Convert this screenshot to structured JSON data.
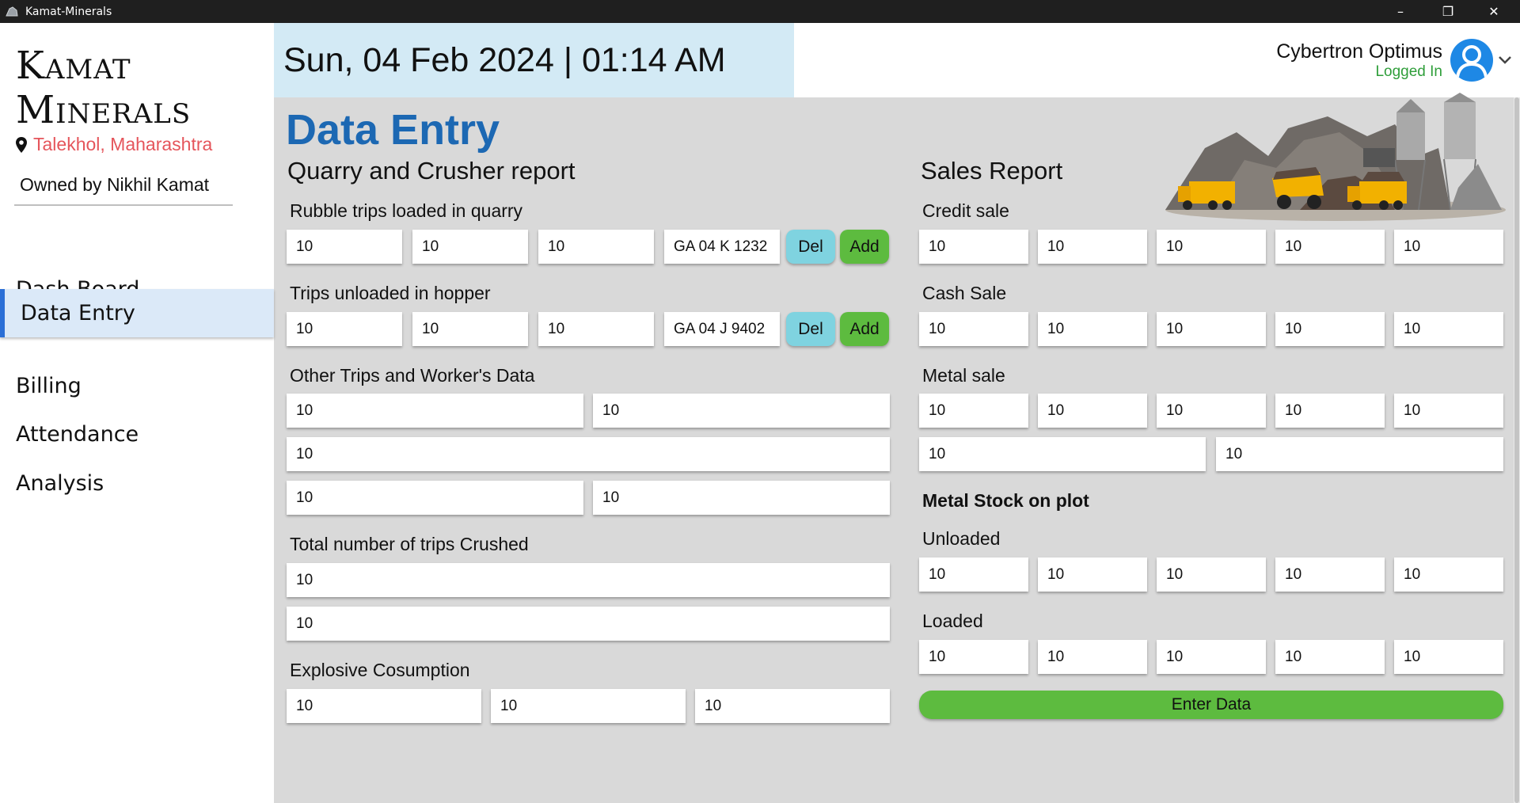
{
  "window": {
    "title": "Kamat-Minerals",
    "controls": [
      "–",
      "❐",
      "✕"
    ]
  },
  "sidebar": {
    "brand_line1": "Kamat",
    "brand_line2": "Minerals",
    "location": "Talekhol, Maharashtra",
    "owner": "Owned by Nikhil Kamat",
    "items": [
      {
        "label": "Dash Board"
      },
      {
        "label": "Data Entry",
        "active": true
      },
      {
        "label": "Billing"
      },
      {
        "label": "Attendance"
      },
      {
        "label": "Analysis"
      }
    ]
  },
  "header": {
    "datetime": "Sun, 04 Feb 2024 | 01:14 AM",
    "user_name": "Cybertron Optimus",
    "user_status": "Logged In"
  },
  "main": {
    "title": "Data Entry",
    "quarry": {
      "title": "Quarry and Crusher report",
      "rubble_label": "Rubble trips loaded in quarry",
      "rubble_values": [
        "10",
        "10",
        "10",
        "GA 04 K 1232"
      ],
      "hopper_label": "Trips unloaded in hopper",
      "hopper_values": [
        "10",
        "10",
        "10",
        "GA 04 J 9402"
      ],
      "del_label": "Del",
      "add_label": "Add",
      "other_label": "Other Trips and Worker's Data",
      "other_values": [
        "10",
        "10",
        "10",
        "10",
        "10"
      ],
      "crushed_label": "Total number of trips Crushed",
      "crushed_values": [
        "10",
        "10"
      ],
      "explosive_label": "Explosive Cosumption",
      "explosive_values": [
        "10",
        "10",
        "10"
      ]
    },
    "sales": {
      "title": "Sales Report",
      "credit_label": "Credit sale",
      "credit_values": [
        "10",
        "10",
        "10",
        "10",
        "10"
      ],
      "cash_label": "Cash Sale",
      "cash_values": [
        "10",
        "10",
        "10",
        "10",
        "10"
      ],
      "metal_label": "Metal sale",
      "metal_values": [
        "10",
        "10",
        "10",
        "10",
        "10",
        "10",
        "10"
      ],
      "stock_label": "Metal Stock on plot",
      "unloaded_label": "Unloaded",
      "unloaded_values": [
        "10",
        "10",
        "10",
        "10",
        "10"
      ],
      "loaded_label": "Loaded",
      "loaded_values": [
        "10",
        "10",
        "10",
        "10",
        "10"
      ],
      "enter_label": "Enter Data"
    }
  },
  "colors": {
    "accent_title": "#1c68b3",
    "add_button": "#5dbb3f",
    "del_button": "#7fd3e0",
    "date_bg": "#d3eaf5",
    "active_nav_bg": "#dbe9f8",
    "location_text": "#e5555b",
    "logged_in": "#2f9e3a"
  },
  "icons": [
    "app-icon",
    "minimize-icon",
    "restore-icon",
    "close-icon",
    "location-pin-icon",
    "user-avatar-icon",
    "chevron-down-icon",
    "mining-trucks-illustration"
  ]
}
